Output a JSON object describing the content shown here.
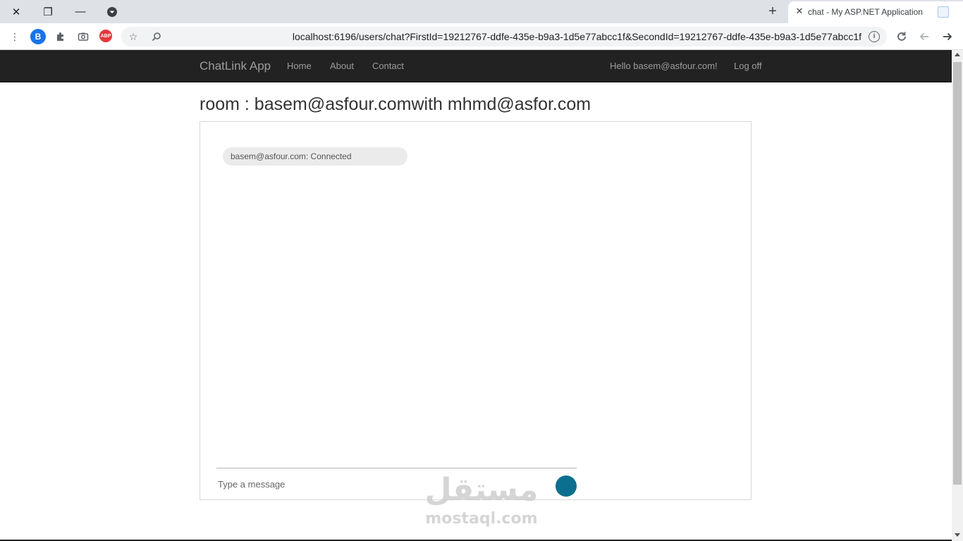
{
  "browser": {
    "tab_title": "chat - My ASP.NET Application",
    "url": "localhost:6196/users/chat?FirstId=19212767-ddfe-435e-b9a3-1d5e77abcc1f&SecondId=19212767-ddfe-435e-b9a3-1d5e77abcc1f",
    "profile_initial": "B",
    "abp_label": "ABP",
    "info_label": "i"
  },
  "navbar": {
    "brand": "ChatLink App",
    "links": [
      "Home",
      "About",
      "Contact"
    ],
    "greeting": "Hello basem@asfour.com!",
    "logoff": "Log off"
  },
  "room": {
    "title": "room : basem@asfour.comwith mhmd@asfor.com",
    "messages": [
      {
        "text": "basem@asfour.com: Connected"
      }
    ],
    "composer_placeholder": "Type a message"
  },
  "watermark": {
    "arabic": "مستقل",
    "latin": "mostaql.com"
  },
  "colors": {
    "navbar_bg": "#222222",
    "send_button": "#0c6f8f",
    "bubble_bg": "#ebebeb"
  }
}
